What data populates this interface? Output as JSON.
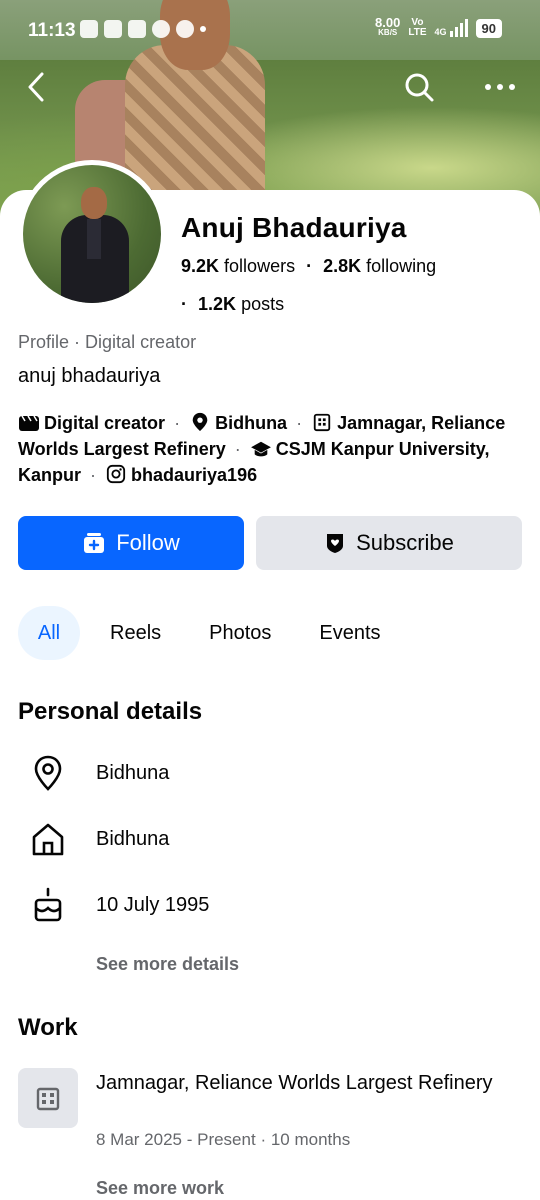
{
  "status_bar": {
    "time": "11:13",
    "speed_value": "8.00",
    "speed_unit": "KB/S",
    "volte_top": "Vo",
    "volte_bottom": "LTE",
    "network": "4G",
    "battery": "90"
  },
  "profile": {
    "name": "Anuj Bhadauriya",
    "followers_count": "9.2K",
    "followers_label": "followers",
    "following_count": "2.8K",
    "following_label": "following",
    "posts_count": "1.2K",
    "posts_label": "posts",
    "category_prefix": "Profile",
    "category": "Digital creator",
    "bio": "anuj bhadauriya"
  },
  "intro_items": {
    "category": "Digital creator",
    "location": "Bidhuna",
    "work": "Jamnagar, Reliance Worlds Largest Refinery",
    "education": "CSJM Kanpur University, Kanpur",
    "instagram": "bhadauriya196"
  },
  "buttons": {
    "follow": "Follow",
    "subscribe": "Subscribe"
  },
  "tabs": [
    "All",
    "Reels",
    "Photos",
    "Events"
  ],
  "personal_details": {
    "title": "Personal details",
    "current_city": "Bidhuna",
    "hometown": "Bidhuna",
    "birthday": "10 July 1995",
    "see_more": "See more details"
  },
  "work": {
    "title": "Work",
    "position": "Jamnagar, Reliance Worlds Largest Refinery",
    "dates": "8 Mar 2025 - Present",
    "duration": "10 months",
    "see_more": "See more work"
  },
  "colors": {
    "accent": "#0866ff",
    "secondary_button": "#e4e6eb",
    "muted_text": "#65676b",
    "active_tab_bg": "#ebf5ff"
  }
}
